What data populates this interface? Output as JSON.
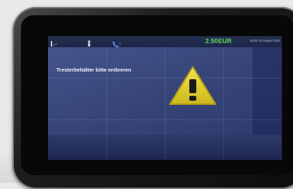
{
  "status_bar": {
    "price": "2.50EUR",
    "datetime": "20:02 22 August 2021"
  },
  "message": {
    "text": "Tresterbehälter bitte entleeren"
  },
  "icons": {
    "wifi": "wifi-icon",
    "person": "person-icon",
    "phone": "phone-icon",
    "warning": "warning-icon"
  },
  "colors": {
    "price": "#5dde5d",
    "warning_fill": "#e9d432",
    "screen_bg": "#2a3668"
  }
}
